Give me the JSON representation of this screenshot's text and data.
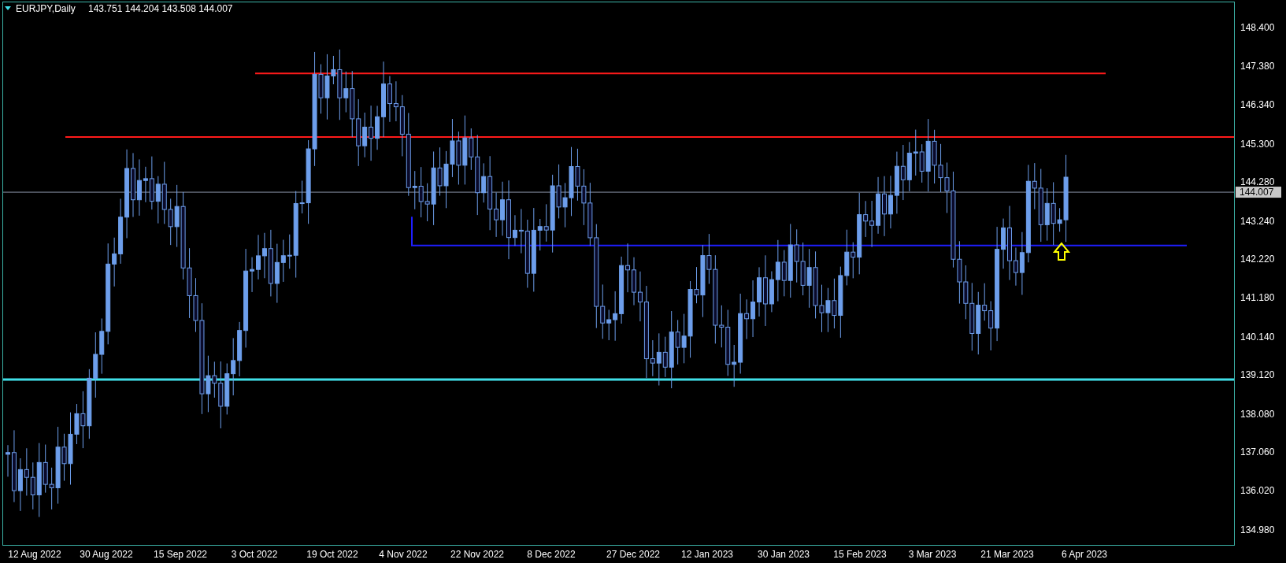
{
  "header": {
    "symbol": "EURJPY,Daily",
    "quotes": "143.751 144.204 143.508 144.007"
  },
  "price_axis": [
    "148.400",
    "147.380",
    "146.340",
    "145.300",
    "144.280",
    "143.240",
    "142.220",
    "141.180",
    "140.140",
    "139.120",
    "138.080",
    "137.060",
    "136.020",
    "134.980"
  ],
  "current_price": "144.007",
  "date_axis": [
    "12 Aug 2022",
    "30 Aug 2022",
    "15 Sep 2022",
    "3 Oct 2022",
    "19 Oct 2022",
    "4 Nov 2022",
    "22 Nov 2022",
    "8 Dec 2022",
    "27 Dec 2022",
    "12 Jan 2023",
    "30 Jan 2023",
    "15 Feb 2023",
    "3 Mar 2023",
    "21 Mar 2023",
    "6 Apr 2023"
  ]
}
